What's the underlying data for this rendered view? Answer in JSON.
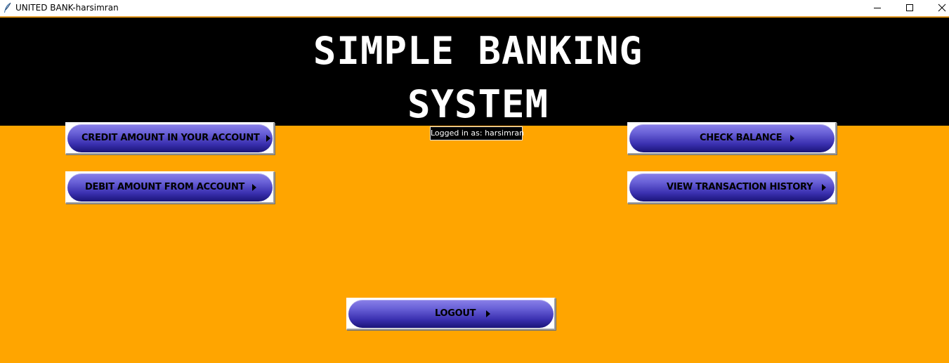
{
  "window": {
    "title": "UNITED BANK-harsimran",
    "icon": "feather-icon"
  },
  "banner": {
    "line1": "SIMPLE BANKING",
    "line2": "SYSTEM"
  },
  "status": {
    "text": "Logged in as: harsimran"
  },
  "buttons": {
    "credit": "CREDIT AMOUNT IN YOUR ACCOUNT",
    "debit": "DEBIT AMOUNT FROM ACCOUNT",
    "balance": "CHECK BALANCE",
    "history": "VIEW TRANSACTION HISTORY",
    "logout": "LOGOUT"
  },
  "colors": {
    "background": "#FFA500",
    "banner": "#000000",
    "button_gradient_top": "#8a80e8",
    "button_gradient_bottom": "#1a1478"
  }
}
